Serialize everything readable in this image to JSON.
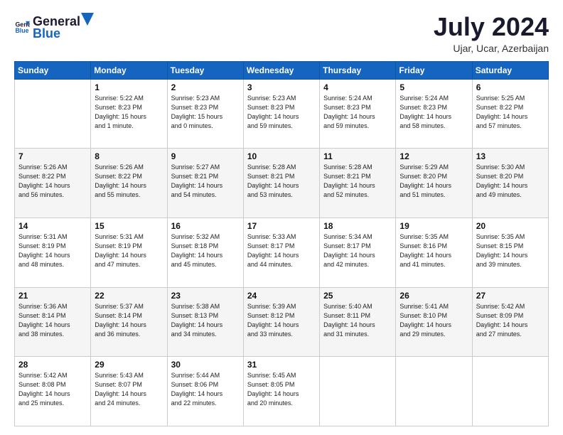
{
  "logo": {
    "text1": "General",
    "text2": "Blue"
  },
  "title": "July 2024",
  "subtitle": "Ujar, Ucar, Azerbaijan",
  "days_of_week": [
    "Sunday",
    "Monday",
    "Tuesday",
    "Wednesday",
    "Thursday",
    "Friday",
    "Saturday"
  ],
  "weeks": [
    [
      {
        "day": "",
        "info": ""
      },
      {
        "day": "1",
        "info": "Sunrise: 5:22 AM\nSunset: 8:23 PM\nDaylight: 15 hours\nand 1 minute."
      },
      {
        "day": "2",
        "info": "Sunrise: 5:23 AM\nSunset: 8:23 PM\nDaylight: 15 hours\nand 0 minutes."
      },
      {
        "day": "3",
        "info": "Sunrise: 5:23 AM\nSunset: 8:23 PM\nDaylight: 14 hours\nand 59 minutes."
      },
      {
        "day": "4",
        "info": "Sunrise: 5:24 AM\nSunset: 8:23 PM\nDaylight: 14 hours\nand 59 minutes."
      },
      {
        "day": "5",
        "info": "Sunrise: 5:24 AM\nSunset: 8:23 PM\nDaylight: 14 hours\nand 58 minutes."
      },
      {
        "day": "6",
        "info": "Sunrise: 5:25 AM\nSunset: 8:22 PM\nDaylight: 14 hours\nand 57 minutes."
      }
    ],
    [
      {
        "day": "7",
        "info": "Sunrise: 5:26 AM\nSunset: 8:22 PM\nDaylight: 14 hours\nand 56 minutes."
      },
      {
        "day": "8",
        "info": "Sunrise: 5:26 AM\nSunset: 8:22 PM\nDaylight: 14 hours\nand 55 minutes."
      },
      {
        "day": "9",
        "info": "Sunrise: 5:27 AM\nSunset: 8:21 PM\nDaylight: 14 hours\nand 54 minutes."
      },
      {
        "day": "10",
        "info": "Sunrise: 5:28 AM\nSunset: 8:21 PM\nDaylight: 14 hours\nand 53 minutes."
      },
      {
        "day": "11",
        "info": "Sunrise: 5:28 AM\nSunset: 8:21 PM\nDaylight: 14 hours\nand 52 minutes."
      },
      {
        "day": "12",
        "info": "Sunrise: 5:29 AM\nSunset: 8:20 PM\nDaylight: 14 hours\nand 51 minutes."
      },
      {
        "day": "13",
        "info": "Sunrise: 5:30 AM\nSunset: 8:20 PM\nDaylight: 14 hours\nand 49 minutes."
      }
    ],
    [
      {
        "day": "14",
        "info": "Sunrise: 5:31 AM\nSunset: 8:19 PM\nDaylight: 14 hours\nand 48 minutes."
      },
      {
        "day": "15",
        "info": "Sunrise: 5:31 AM\nSunset: 8:19 PM\nDaylight: 14 hours\nand 47 minutes."
      },
      {
        "day": "16",
        "info": "Sunrise: 5:32 AM\nSunset: 8:18 PM\nDaylight: 14 hours\nand 45 minutes."
      },
      {
        "day": "17",
        "info": "Sunrise: 5:33 AM\nSunset: 8:17 PM\nDaylight: 14 hours\nand 44 minutes."
      },
      {
        "day": "18",
        "info": "Sunrise: 5:34 AM\nSunset: 8:17 PM\nDaylight: 14 hours\nand 42 minutes."
      },
      {
        "day": "19",
        "info": "Sunrise: 5:35 AM\nSunset: 8:16 PM\nDaylight: 14 hours\nand 41 minutes."
      },
      {
        "day": "20",
        "info": "Sunrise: 5:35 AM\nSunset: 8:15 PM\nDaylight: 14 hours\nand 39 minutes."
      }
    ],
    [
      {
        "day": "21",
        "info": "Sunrise: 5:36 AM\nSunset: 8:14 PM\nDaylight: 14 hours\nand 38 minutes."
      },
      {
        "day": "22",
        "info": "Sunrise: 5:37 AM\nSunset: 8:14 PM\nDaylight: 14 hours\nand 36 minutes."
      },
      {
        "day": "23",
        "info": "Sunrise: 5:38 AM\nSunset: 8:13 PM\nDaylight: 14 hours\nand 34 minutes."
      },
      {
        "day": "24",
        "info": "Sunrise: 5:39 AM\nSunset: 8:12 PM\nDaylight: 14 hours\nand 33 minutes."
      },
      {
        "day": "25",
        "info": "Sunrise: 5:40 AM\nSunset: 8:11 PM\nDaylight: 14 hours\nand 31 minutes."
      },
      {
        "day": "26",
        "info": "Sunrise: 5:41 AM\nSunset: 8:10 PM\nDaylight: 14 hours\nand 29 minutes."
      },
      {
        "day": "27",
        "info": "Sunrise: 5:42 AM\nSunset: 8:09 PM\nDaylight: 14 hours\nand 27 minutes."
      }
    ],
    [
      {
        "day": "28",
        "info": "Sunrise: 5:42 AM\nSunset: 8:08 PM\nDaylight: 14 hours\nand 25 minutes."
      },
      {
        "day": "29",
        "info": "Sunrise: 5:43 AM\nSunset: 8:07 PM\nDaylight: 14 hours\nand 24 minutes."
      },
      {
        "day": "30",
        "info": "Sunrise: 5:44 AM\nSunset: 8:06 PM\nDaylight: 14 hours\nand 22 minutes."
      },
      {
        "day": "31",
        "info": "Sunrise: 5:45 AM\nSunset: 8:05 PM\nDaylight: 14 hours\nand 20 minutes."
      },
      {
        "day": "",
        "info": ""
      },
      {
        "day": "",
        "info": ""
      },
      {
        "day": "",
        "info": ""
      }
    ]
  ]
}
